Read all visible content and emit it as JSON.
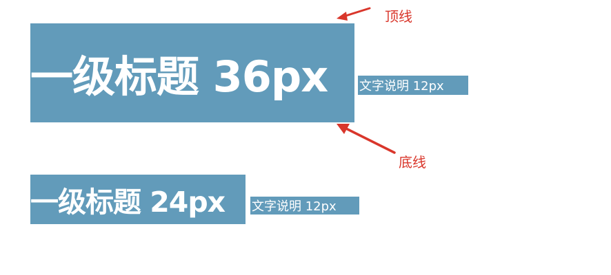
{
  "samples": [
    {
      "heading": "一级标题 36px",
      "caption": "文字说明 12px"
    },
    {
      "heading": "一级标题 24px",
      "caption": "文字说明 12px"
    }
  ],
  "annotations": {
    "top_line": "顶线",
    "bottom_line": "底线"
  },
  "colors": {
    "box_background": "#629bba",
    "box_text": "#ffffff",
    "annotation": "#d9362b"
  }
}
